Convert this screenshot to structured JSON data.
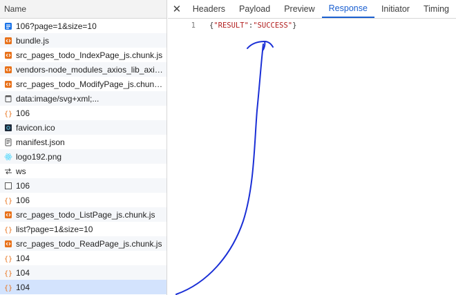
{
  "left_panel": {
    "header": "Name",
    "requests": [
      {
        "name": "106?page=1&size=10",
        "icon": "document-icon"
      },
      {
        "name": "bundle.js",
        "icon": "script-icon"
      },
      {
        "name": "src_pages_todo_IndexPage_js.chunk.js",
        "icon": "script-icon"
      },
      {
        "name": "vendors-node_modules_axios_lib_axios...",
        "icon": "script-icon"
      },
      {
        "name": "src_pages_todo_ModifyPage_js.chunk.js",
        "icon": "script-icon"
      },
      {
        "name": "data:image/svg+xml;...",
        "icon": "file-icon"
      },
      {
        "name": "106",
        "icon": "fetch-icon"
      },
      {
        "name": "favicon.ico",
        "icon": "favicon-icon"
      },
      {
        "name": "manifest.json",
        "icon": "manifest-icon"
      },
      {
        "name": "logo192.png",
        "icon": "react-logo-icon"
      },
      {
        "name": "ws",
        "icon": "websocket-icon"
      },
      {
        "name": "106",
        "icon": "blank-doc-icon"
      },
      {
        "name": "106",
        "icon": "fetch-icon"
      },
      {
        "name": "src_pages_todo_ListPage_js.chunk.js",
        "icon": "script-icon"
      },
      {
        "name": "list?page=1&size=10",
        "icon": "fetch-icon"
      },
      {
        "name": "src_pages_todo_ReadPage_js.chunk.js",
        "icon": "script-icon"
      },
      {
        "name": "104",
        "icon": "fetch-icon"
      },
      {
        "name": "104",
        "icon": "fetch-icon"
      },
      {
        "name": "104",
        "icon": "fetch-icon"
      }
    ]
  },
  "detail_panel": {
    "close_symbol": "✕",
    "tabs": [
      "Headers",
      "Payload",
      "Preview",
      "Response",
      "Initiator",
      "Timing"
    ],
    "active_tab": "Response",
    "response": {
      "line_number": "1",
      "open_brace": "{",
      "key": "\"RESULT\"",
      "colon": ":",
      "value": "\"SUCCESS\"",
      "close_brace": "}"
    }
  },
  "colors": {
    "accent": "#1a5fd0",
    "selected_row": "#d3e3fd",
    "annotation": "#1a2fd6",
    "script_icon": "#e8711a"
  }
}
